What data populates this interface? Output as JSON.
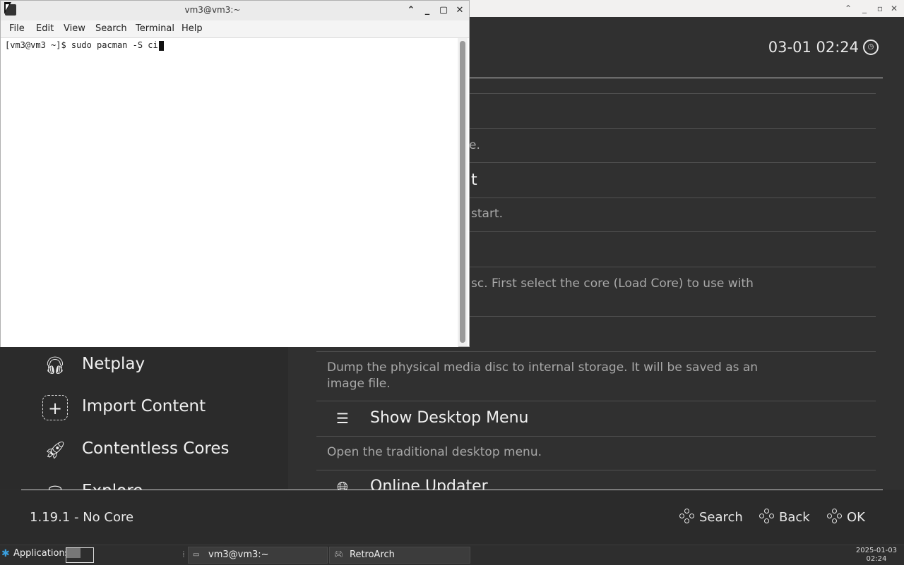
{
  "retroarch": {
    "clock": "03-01 02:24",
    "sidebar": [
      {
        "label": "Netplay",
        "icon": "headset-icon"
      },
      {
        "label": "Import Content",
        "icon": "plus-icon"
      },
      {
        "label": "Contentless Cores",
        "icon": "rocket-icon"
      },
      {
        "label": "Explore",
        "icon": "database-icon"
      }
    ],
    "fragments": {
      "frag1_desc": "e.",
      "frag2_title": "t",
      "frag2_desc": "start.",
      "frag3_desc": "sc. First select the core (Load Core) to use with"
    },
    "menu": [
      {
        "title": "",
        "desc": "Dump the physical media disc to internal storage. It will be saved as an\nimage file."
      },
      {
        "title": "Show Desktop Menu",
        "desc": "Open the traditional desktop menu.",
        "icon": "list-icon"
      },
      {
        "title": "Online Updater",
        "desc": "",
        "icon": "globe-icon"
      }
    ],
    "footer": {
      "version": "1.19.1 - No Core",
      "search": "Search",
      "back": "Back",
      "ok": "OK"
    }
  },
  "terminal": {
    "title": "vm3@vm3:~",
    "menus": [
      "File",
      "Edit",
      "View",
      "Search",
      "Terminal",
      "Help"
    ],
    "prompt": "[vm3@vm3 ~]$ sudo pacman -S ci"
  },
  "taskbar": {
    "applications": "Applications",
    "tasks": [
      "vm3@vm3:~",
      "RetroArch"
    ],
    "date": "2025-01-03",
    "time": "02:24"
  }
}
